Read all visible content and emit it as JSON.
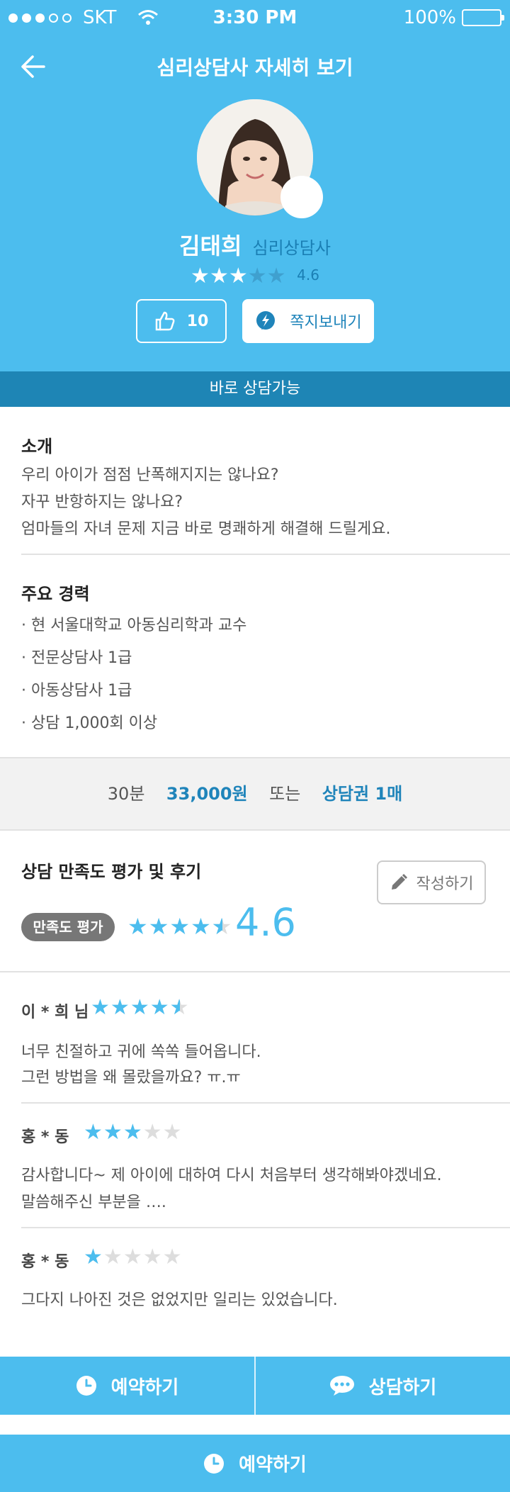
{
  "status": {
    "carrier": "SKT",
    "time": "3:30 PM",
    "battery": "100%",
    "signal_bars_filled": 3,
    "signal_bars_total": 5
  },
  "header": {
    "title": "심리상담사 자세히 보기"
  },
  "profile": {
    "name": "김태희",
    "role": "심리상담사",
    "rating": "4.6",
    "likes": "10",
    "message_label": "쪽지보내기",
    "availability": "바로 상담가능"
  },
  "intro": {
    "title": "소개",
    "lines": [
      "우리 아이가 점점 난폭해지지는 않나요?",
      "자꾸 반항하지는 않나요?",
      "엄마들의 자녀 문제 지금 바로 명쾌하게 해결해 드릴게요."
    ]
  },
  "career": {
    "title": "주요 경력",
    "items": [
      "· 현 서울대학교 아동심리학과 교수",
      "· 전문상담사 1급",
      "· 아동상담사 1급",
      "· 상담 1,000회 이상"
    ]
  },
  "price": {
    "duration": "30분",
    "amount": "33,000원",
    "or": "또는",
    "voucher": "상담권 1매"
  },
  "reviews": {
    "title": "상담 만족도 평가 및 후기",
    "write_label": "작성하기",
    "badge": "만족도 평가",
    "score": "4.6",
    "score_stars": 4.6,
    "items": [
      {
        "name": "이 * 희 님",
        "stars": 4.5,
        "lines": [
          "너무 친절하고 귀에 쏙쏙 들어옵니다.",
          "그런 방법을 왜 몰랐을까요? ㅠ.ㅠ"
        ]
      },
      {
        "name": "홍 * 동",
        "stars": 3,
        "lines": [
          "감사합니다~ 제 아이에 대하여 다시 처음부터 생각해봐야겠네요.",
          "말씀해주신 부분을 …."
        ]
      },
      {
        "name": "홍 * 동",
        "stars": 1,
        "lines": [
          "그다지 나아진 것은 없었지만 일리는 있었습니다."
        ]
      }
    ]
  },
  "tabs": {
    "reserve": "예약하기",
    "consult": "상담하기"
  },
  "bottom": {
    "reserve": "예약하기"
  },
  "colors": {
    "primary": "#4cbdee",
    "dark_band": "#1e85b5",
    "accent_text": "#1f84ba"
  }
}
